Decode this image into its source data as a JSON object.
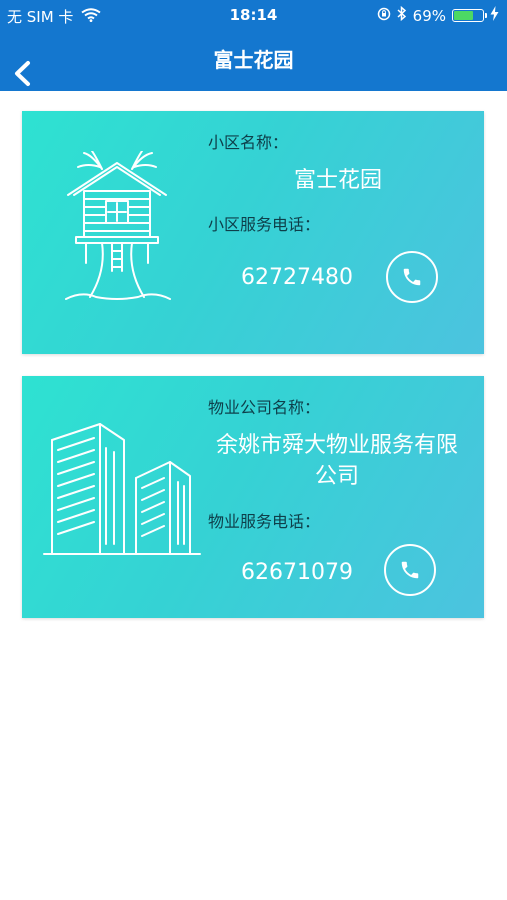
{
  "status_bar": {
    "carrier": "无 SIM 卡",
    "time": "18:14",
    "battery": "69%",
    "battery_level": 0.69
  },
  "nav": {
    "title": "富士花园"
  },
  "community_card": {
    "name_label": "小区名称：",
    "name_value": "富士花园",
    "phone_label": "小区服务电话：",
    "phone_value": "62727480"
  },
  "property_card": {
    "name_label": "物业公司名称：",
    "name_value": "余姚市舜大物业服务有限公司",
    "phone_label": "物业服务电话：",
    "phone_value": "62671079"
  },
  "icons": {
    "back": "chevron-left-icon",
    "call": "phone-icon",
    "wifi": "wifi-icon",
    "bluetooth": "bluetooth-icon",
    "orientation_lock": "orientation-lock-icon",
    "charging": "charging-bolt-icon",
    "treehouse": "treehouse-illustration",
    "buildings": "buildings-illustration"
  },
  "colors": {
    "nav_bar": "#1477cf",
    "card_start": "#2ee2d2",
    "card_end": "#4cc3df",
    "label_text": "#0e3f4a"
  }
}
